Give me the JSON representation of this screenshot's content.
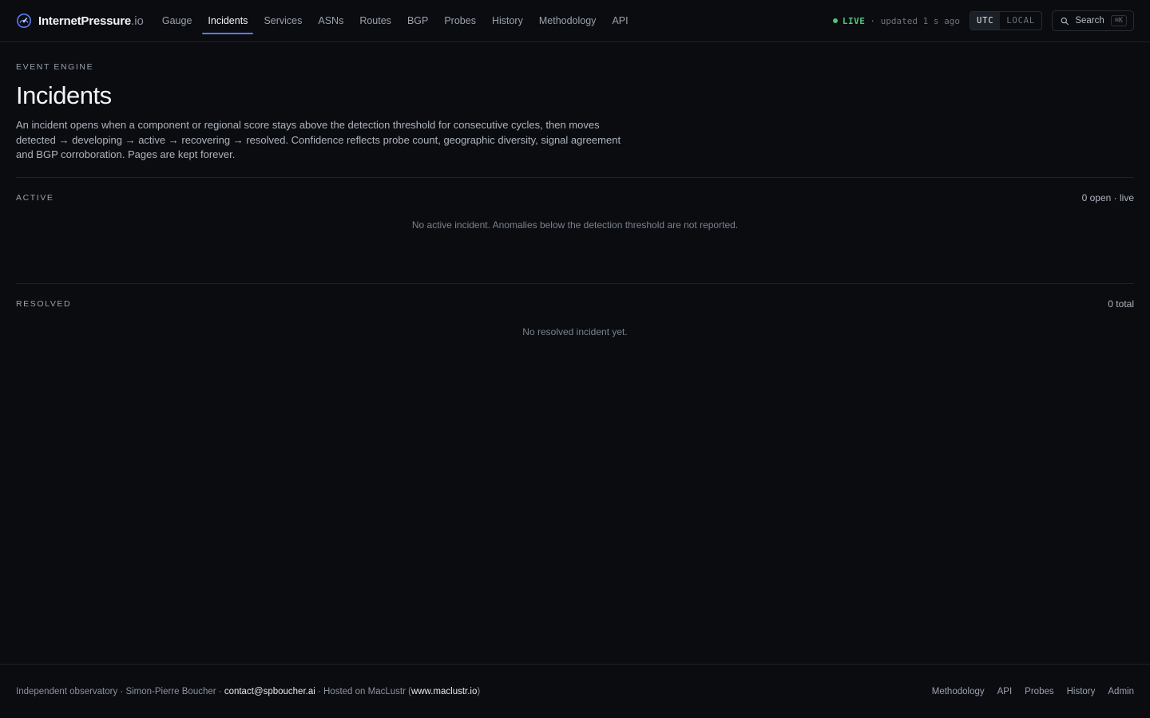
{
  "brand": {
    "name": "InternetPressure",
    "tld": ".io"
  },
  "nav": [
    {
      "label": "Gauge",
      "active": false
    },
    {
      "label": "Incidents",
      "active": true
    },
    {
      "label": "Services",
      "active": false
    },
    {
      "label": "ASNs",
      "active": false
    },
    {
      "label": "Routes",
      "active": false
    },
    {
      "label": "BGP",
      "active": false
    },
    {
      "label": "Probes",
      "active": false
    },
    {
      "label": "History",
      "active": false
    },
    {
      "label": "Methodology",
      "active": false
    },
    {
      "label": "API",
      "active": false
    }
  ],
  "status": {
    "live_label": "LIVE",
    "updated": "· updated 1 s ago",
    "live_color": "#52c27a"
  },
  "timezone": {
    "options": [
      "UTC",
      "LOCAL"
    ],
    "selected": "UTC"
  },
  "search": {
    "label": "Search",
    "shortcut": "⌘K",
    "icon": "search-icon"
  },
  "page": {
    "eyebrow": "EVENT ENGINE",
    "title": "Incidents",
    "lead": "An incident opens when a component or regional score stays above the detection threshold for consecutive cycles, then moves detected → developing → active → recovering → resolved. Confidence reflects probe count, geographic diversity, signal agreement and BGP corroboration. Pages are kept forever."
  },
  "active": {
    "title": "ACTIVE",
    "meta": "0 open · live",
    "empty": "No active incident. Anomalies below the detection threshold are not reported."
  },
  "resolved": {
    "title": "RESOLVED",
    "meta": "0 total",
    "empty": "No resolved incident yet."
  },
  "footer": {
    "left_1": "Independent observatory · Simon-Pierre Boucher · ",
    "email": "contact@spboucher.ai",
    "left_2": " · Hosted on MacLustr (",
    "host_link": "www.maclustr.io",
    "left_3": ")",
    "links": [
      "Methodology",
      "API",
      "Probes",
      "History",
      "Admin"
    ]
  },
  "colors": {
    "background": "#0a0c10",
    "accent": "#5b7cfa"
  }
}
